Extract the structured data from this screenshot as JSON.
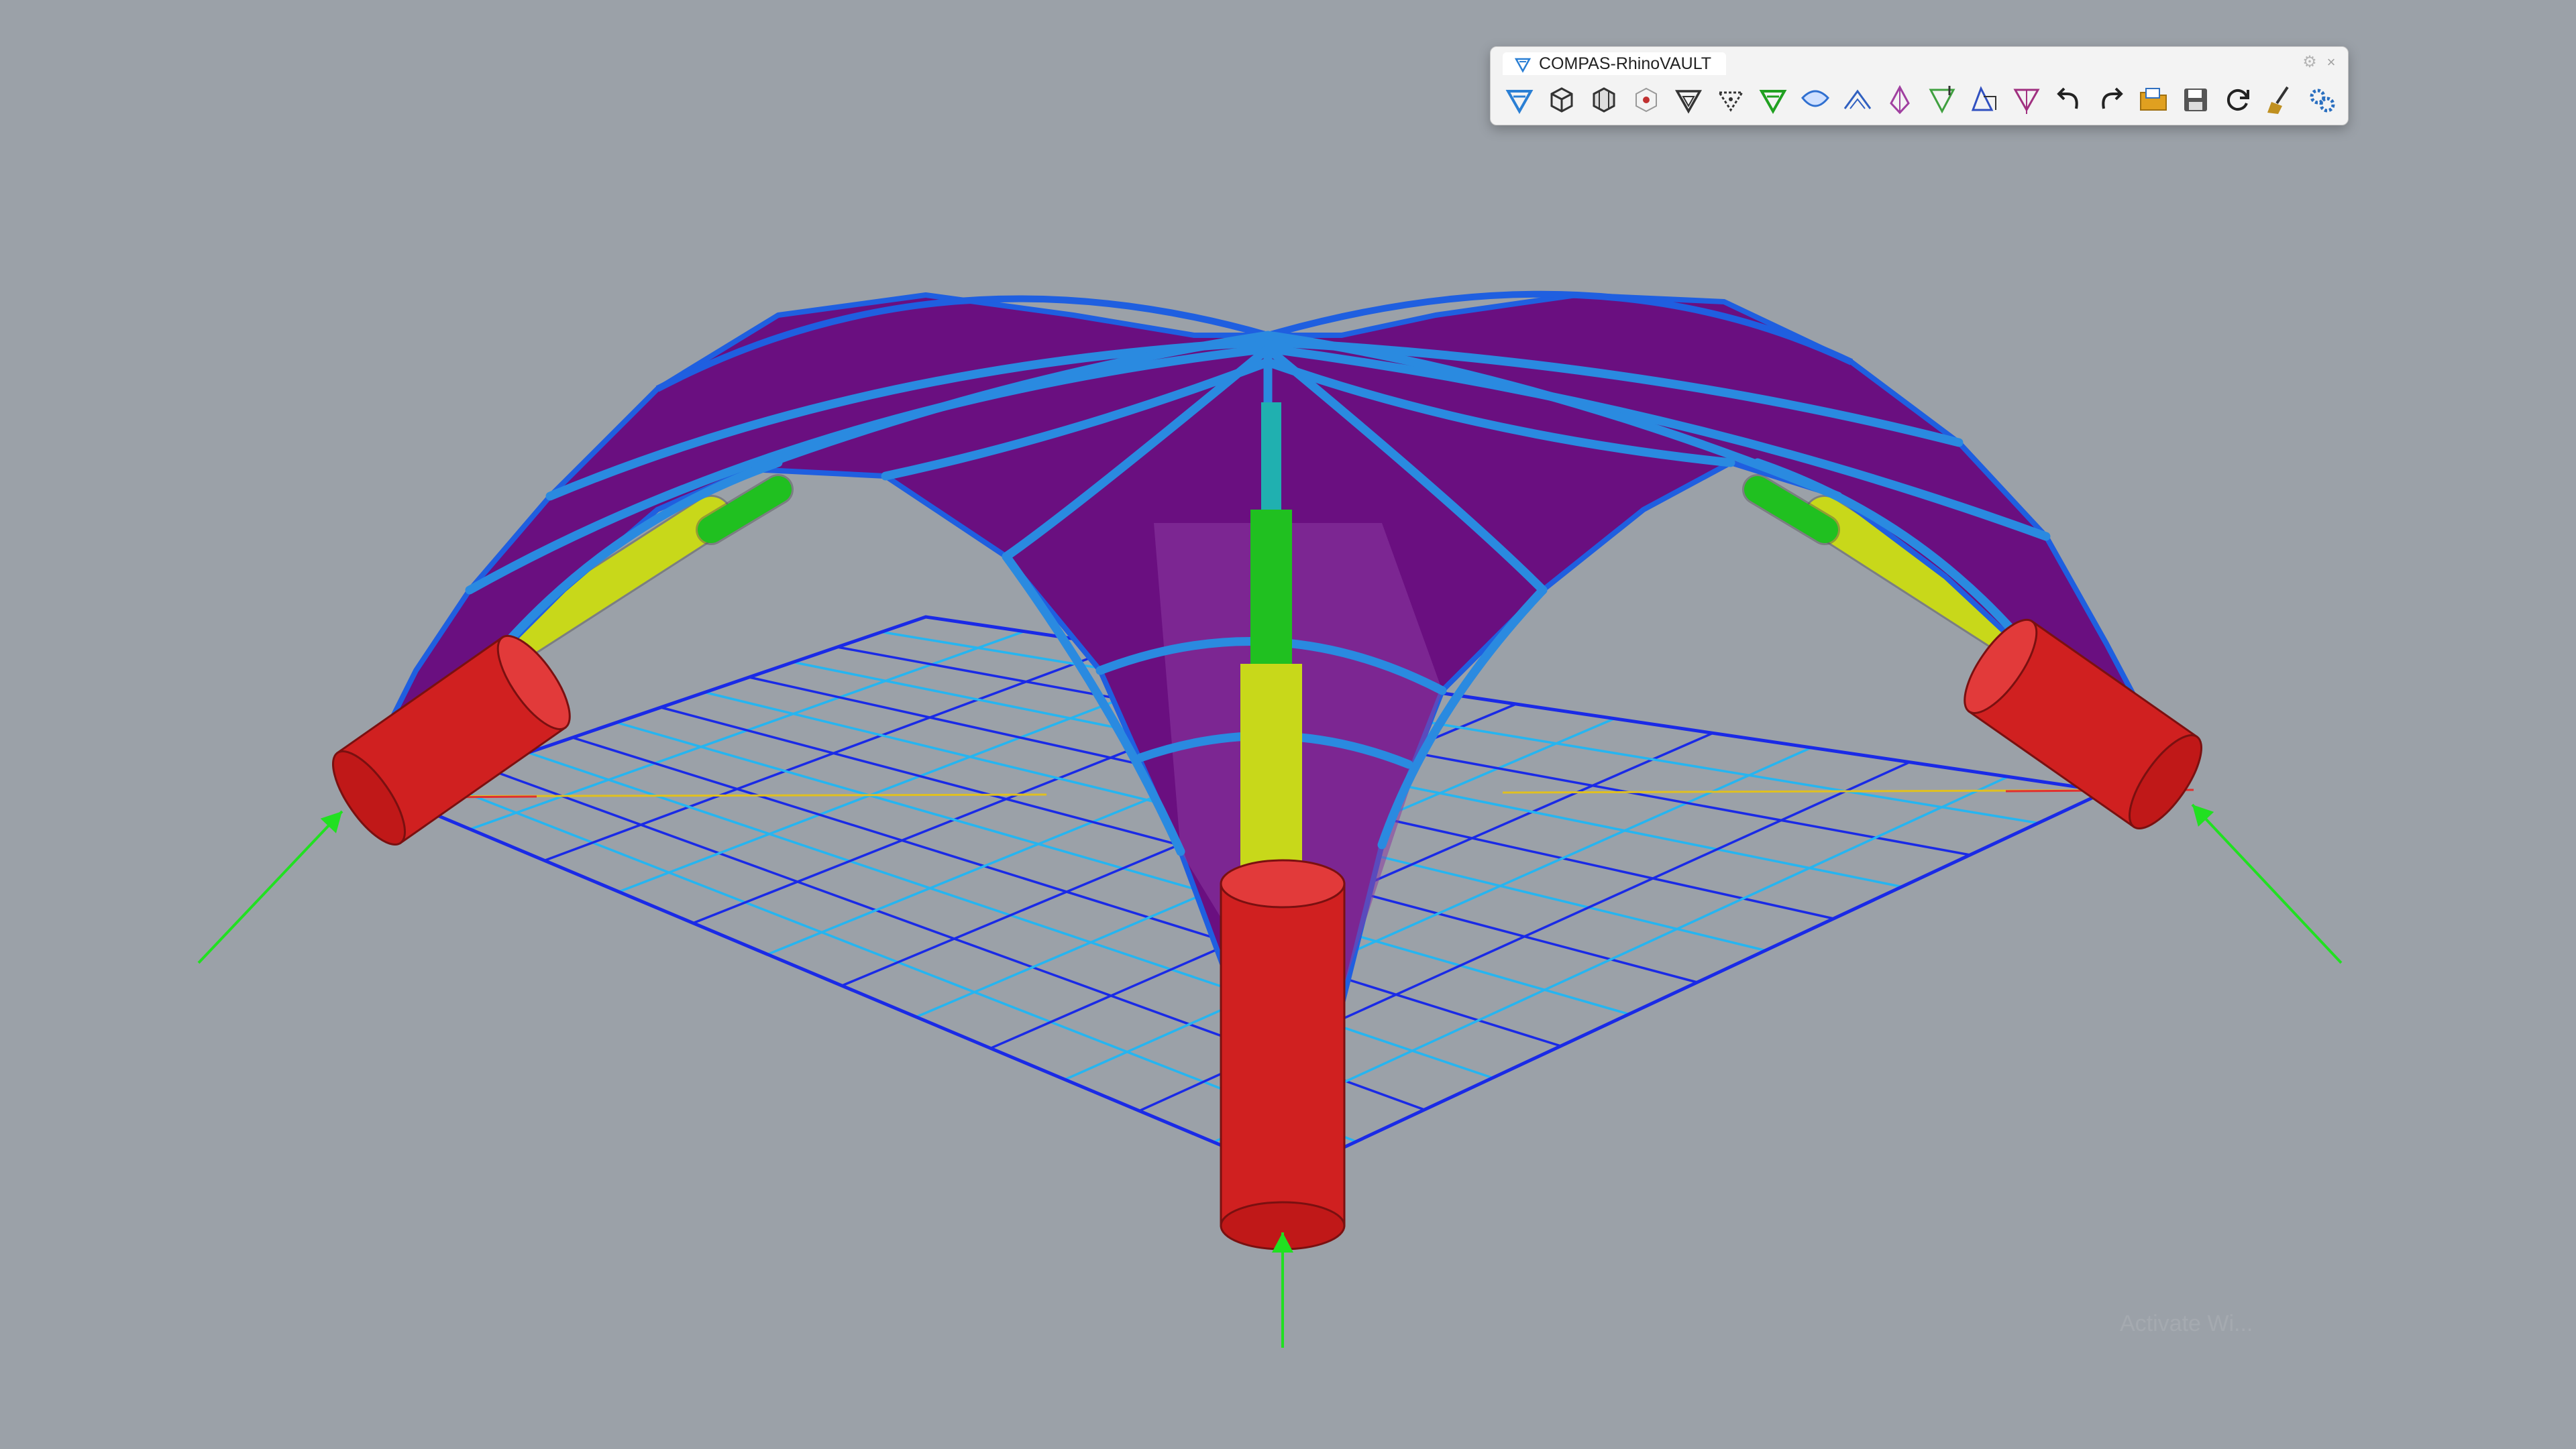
{
  "toolbar": {
    "title": "COMPAS-RhinoVAULT",
    "gear_glyph": "⚙",
    "close_glyph": "×",
    "buttons": [
      {
        "name": "rv-init",
        "icon": "rhinovault-logo-icon",
        "color": "#2a7fd4"
      },
      {
        "name": "rv-pattern",
        "icon": "box-pattern-icon",
        "color": "#333333"
      },
      {
        "name": "rv-pattern-edit",
        "icon": "box-modify-icon",
        "color": "#333333"
      },
      {
        "name": "rv-boundary",
        "icon": "boundary-icon",
        "color": "#c03030"
      },
      {
        "name": "rv-form",
        "icon": "form-diagram-icon",
        "color": "#333333"
      },
      {
        "name": "rv-force",
        "icon": "force-diagram-icon",
        "color": "#333333"
      },
      {
        "name": "rv-tna-horizontal",
        "icon": "horizontal-equilibrium-icon",
        "color": "#20a020"
      },
      {
        "name": "rv-tna-vertical",
        "icon": "vertical-equilibrium-icon",
        "color": "#3070d0"
      },
      {
        "name": "rv-modify-form",
        "icon": "modify-form-icon",
        "color": "#3060c0"
      },
      {
        "name": "rv-modify-force",
        "icon": "modify-force-icon",
        "color": "#a040a0"
      },
      {
        "name": "rv-modify-thrust",
        "icon": "modify-thrust-icon",
        "color": "#40a040"
      },
      {
        "name": "rv-modify-supports",
        "icon": "modify-supports-icon",
        "color": "#3050c0"
      },
      {
        "name": "rv-modify-loads",
        "icon": "modify-loads-icon",
        "color": "#a03080"
      },
      {
        "name": "undo",
        "icon": "undo-icon",
        "color": "#222222"
      },
      {
        "name": "redo",
        "icon": "redo-icon",
        "color": "#222222"
      },
      {
        "name": "open",
        "icon": "open-folder-icon",
        "color": "#e0a020"
      },
      {
        "name": "save",
        "icon": "save-disk-icon",
        "color": "#555555"
      },
      {
        "name": "redraw",
        "icon": "refresh-icon",
        "color": "#222222"
      },
      {
        "name": "clear",
        "icon": "broom-icon",
        "color": "#c09020"
      },
      {
        "name": "settings",
        "icon": "settings-gears-icon",
        "color": "#2a6fc0"
      }
    ]
  },
  "scene": {
    "shell_color": "#6a0f80",
    "shell_edge_color": "#1f5fe0",
    "rib_color": "#2a8ae0",
    "support_color": "#d02020",
    "thrust_colors": [
      "#c8d81a",
      "#20c020",
      "#20b0b0"
    ],
    "reaction_color": "#21e021",
    "grid_color": "#1a2ae6",
    "grid_alt_color": "#26b5f0"
  },
  "watermark": "Activate Wi..."
}
